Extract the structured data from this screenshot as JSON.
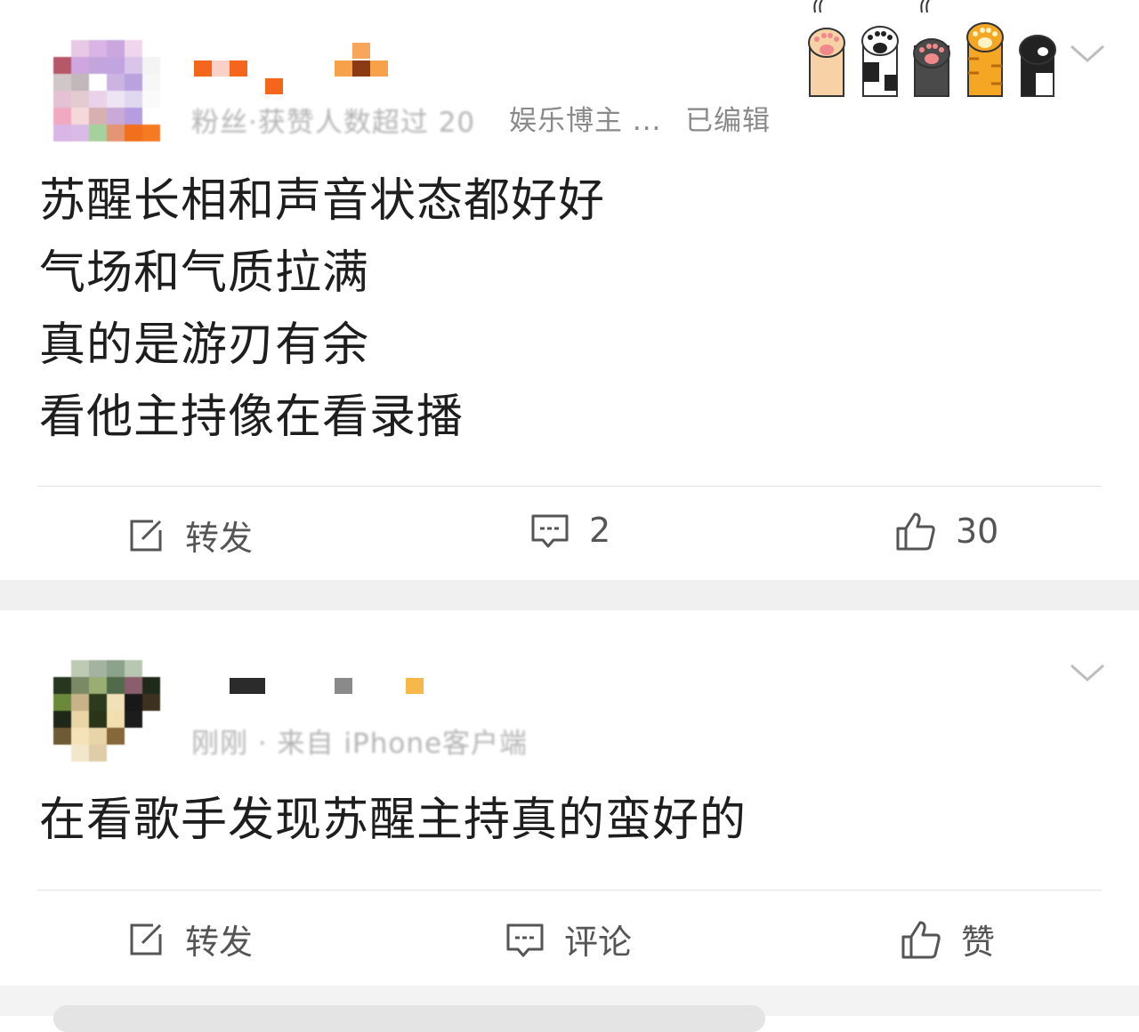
{
  "posts": [
    {
      "meta_text": "粉丝·获赞人数超过 20",
      "meta_tag": "娱乐博主 ...",
      "meta_edited": "已编辑",
      "content_lines": [
        "苏醒长相和声音状态都好好",
        "气场和气质拉满",
        "真的是游刃有余",
        "看他主持像在看录播"
      ],
      "actions": {
        "repost": "转发",
        "comment": "2",
        "like": "30"
      }
    },
    {
      "meta_text": "刚刚 · 来自 iPhone客户端",
      "content_lines": [
        "在看歌手发现苏醒主持真的蛮好的"
      ],
      "actions": {
        "repost": "转发",
        "comment": "评论",
        "like": "赞"
      }
    }
  ],
  "icons": {
    "repost": "edit-square-icon",
    "comment": "comment-bubble-icon",
    "like": "thumbs-up-icon",
    "menu": "chevron-down-icon",
    "decoration": "cat-paws-decoration"
  },
  "colors": {
    "text_primary": "#1e1e1e",
    "text_meta": "#8a8a8a",
    "action_text": "#555555",
    "separator": "#f0f0f0",
    "badge_orange": "#f47a20"
  }
}
